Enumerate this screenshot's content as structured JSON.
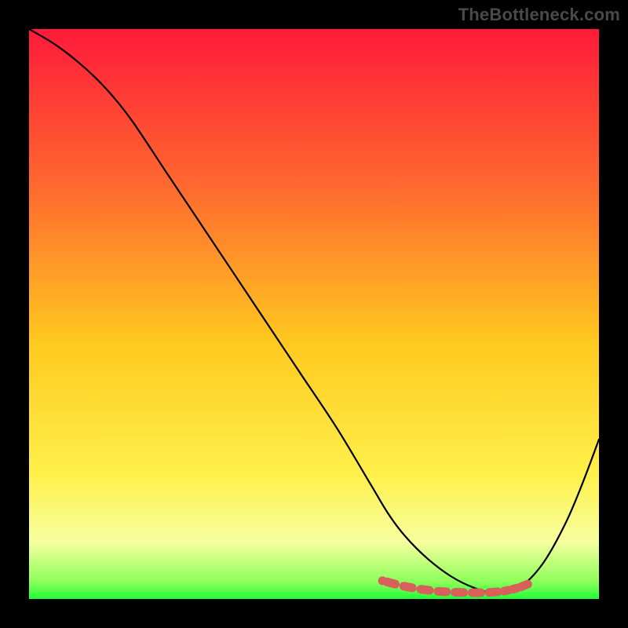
{
  "watermark": "TheBottleneck.com",
  "colors": {
    "background": "#000000",
    "gradient_top": "#ff1a3a",
    "gradient_upper_mid": "#ff8a2a",
    "gradient_mid": "#ffdc20",
    "gradient_lower": "#fff760",
    "gradient_bottom": "#1fff3a",
    "curve": "#000000",
    "marker": "#d9605a"
  },
  "chart_data": {
    "type": "line",
    "title": "",
    "xlabel": "",
    "ylabel": "",
    "xlim": [
      0,
      100
    ],
    "ylim": [
      0,
      100
    ],
    "grid": false,
    "legend": false,
    "series": [
      {
        "name": "bottleneck-curve",
        "x": [
          0,
          5,
          10,
          14,
          18,
          24,
          30,
          36,
          42,
          48,
          54,
          60,
          63,
          66,
          70,
          74,
          78,
          82,
          86,
          90,
          94,
          97,
          100
        ],
        "values": [
          100,
          97,
          93,
          89,
          84,
          75,
          66,
          57,
          48,
          39,
          30,
          20,
          15,
          11,
          7,
          4,
          2,
          1,
          2,
          6,
          13,
          20,
          28
        ]
      }
    ],
    "markers": {
      "name": "optimal-range",
      "x": [
        62,
        65,
        68,
        71,
        74,
        77,
        80,
        83,
        84.5,
        86,
        87.5
      ],
      "values": [
        3.2,
        2.4,
        1.8,
        1.4,
        1.2,
        1.1,
        1.1,
        1.3,
        1.6,
        2.0,
        2.6
      ]
    }
  }
}
